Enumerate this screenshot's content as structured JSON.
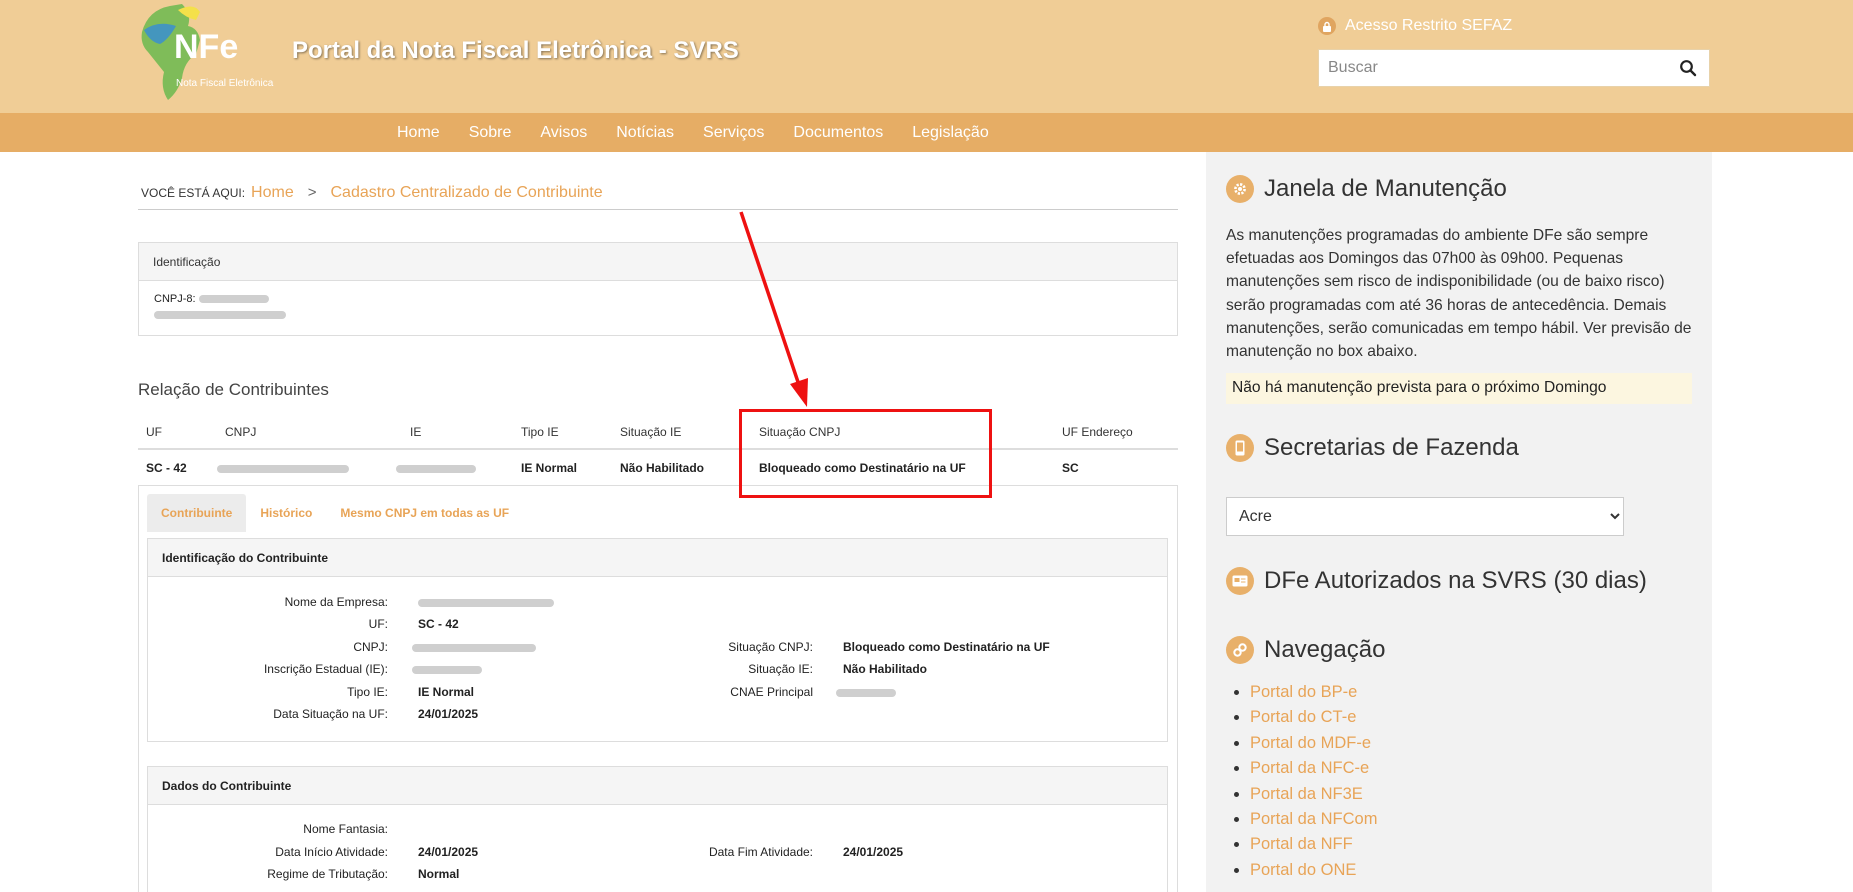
{
  "header": {
    "logo_text": "NFe",
    "logo_subtitle": "Nota Fiscal Eletrônica",
    "site_title": "Portal da Nota Fiscal Eletrônica - SVRS",
    "restricted_access": "Acesso Restrito SEFAZ",
    "search_placeholder": "Buscar"
  },
  "nav": {
    "items": [
      "Home",
      "Sobre",
      "Avisos",
      "Notícias",
      "Serviços",
      "Documentos",
      "Legislação"
    ]
  },
  "breadcrumb": {
    "you_are_here": "Você está aqui:",
    "home": "Home",
    "separator": ">",
    "current": "Cadastro Centralizado de Contribuinte"
  },
  "identificacao": {
    "title": "Identificação",
    "cnpj_label": "CNPJ-8:"
  },
  "relacao": {
    "title": "Relação de Contribuintes",
    "columns": [
      "UF",
      "CNPJ",
      "IE",
      "Tipo IE",
      "Situação IE",
      "Situação CNPJ",
      "UF Endereço"
    ],
    "row": {
      "uf": "SC - 42",
      "tipo_ie": "IE Normal",
      "situacao_ie": "Não Habilitado",
      "situacao_cnpj": "Bloqueado como Destinatário na UF",
      "uf_endereco": "SC"
    }
  },
  "tabs": [
    "Contribuinte",
    "Histórico",
    "Mesmo CNPJ em todas as UF"
  ],
  "identificacao_contribuinte": {
    "title": "Identificação do Contribuinte",
    "nome_empresa_label": "Nome da Empresa:",
    "uf_label": "UF:",
    "uf_value": "SC - 42",
    "cnpj_label": "CNPJ:",
    "ie_label": "Inscrição Estadual (IE):",
    "tipo_ie_label": "Tipo IE:",
    "tipo_ie_value": "IE Normal",
    "data_situacao_label": "Data Situação na UF:",
    "data_situacao_value": "24/01/2025",
    "situacao_cnpj_label": "Situação CNPJ:",
    "situacao_cnpj_value": "Bloqueado como Destinatário na UF",
    "situacao_ie_label": "Situação IE:",
    "situacao_ie_value": "Não Habilitado",
    "cnae_label": "CNAE Principal"
  },
  "dados_contribuinte": {
    "title": "Dados do Contribuinte",
    "nome_fantasia_label": "Nome Fantasia:",
    "data_inicio_label": "Data Início Atividade:",
    "data_inicio_value": "24/01/2025",
    "data_fim_label": "Data Fim Atividade:",
    "data_fim_value": "24/01/2025",
    "regime_label": "Regime de Tributação:",
    "regime_value": "Normal"
  },
  "sidebar": {
    "manutencao_title": "Janela de Manutenção",
    "manutencao_text": "As manutenções programadas do ambiente DFe são sempre efetuadas aos Domingos das 07h00 às 09h00. Pequenas manutenções sem risco de indisponibilidade (ou de baixo risco) serão programadas com até 36 horas de antecedência. Demais manutenções, serão comunicadas em tempo hábil. Ver previsão de manutenção no box abaixo.",
    "manutencao_notice": "Não há manutenção prevista para o próximo Domingo",
    "secretarias_title": "Secretarias de Fazenda",
    "secretarias_selected": "Acre",
    "dfe_title": "DFe Autorizados na SVRS (30 dias)",
    "navegacao_title": "Navegação",
    "navegacao_links": [
      "Portal do BP-e",
      "Portal do CT-e",
      "Portal do MDF-e",
      "Portal da NFC-e",
      "Portal da NF3E",
      "Portal da NFCom",
      "Portal da NFF",
      "Portal do ONE"
    ]
  },
  "colors": {
    "header_bg": "#f0cd96",
    "nav_bg": "#e6ad65",
    "link": "#e8a457",
    "highlight_red": "#ee1111"
  }
}
